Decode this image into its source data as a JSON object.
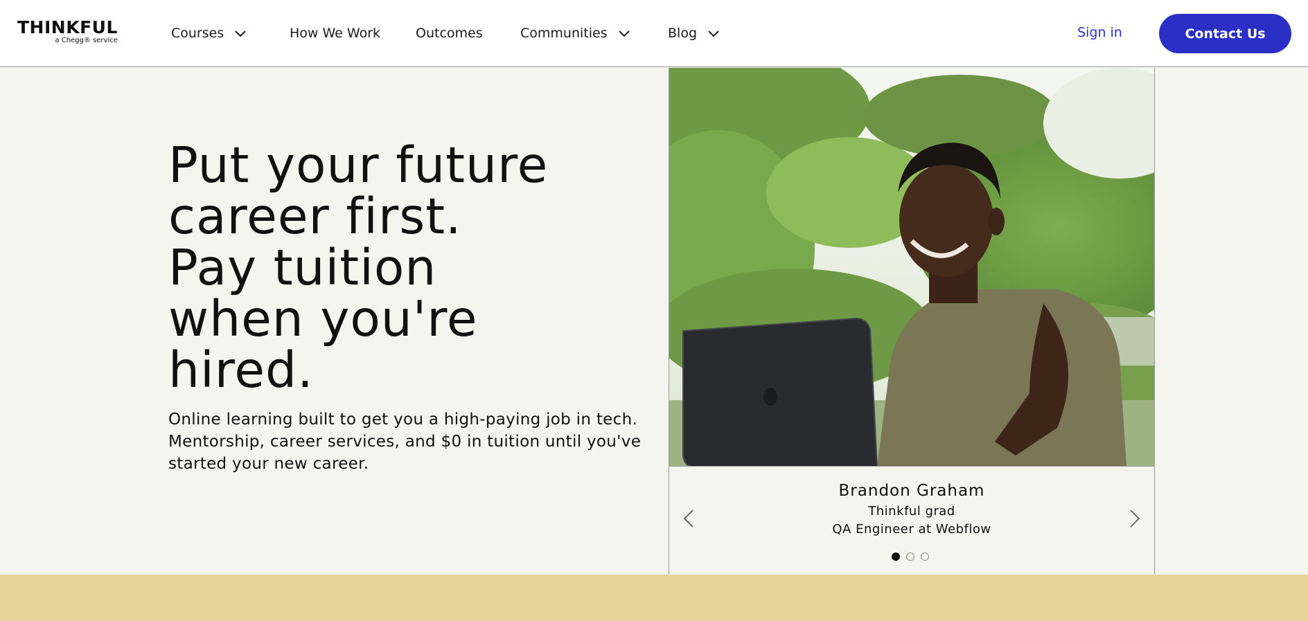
{
  "header": {
    "logo": {
      "word": "THINKFUL",
      "sub": "a Chegg® service"
    },
    "nav": [
      {
        "label": "Courses",
        "dropdown": true
      },
      {
        "label": "How We Work",
        "dropdown": false
      },
      {
        "label": "Outcomes",
        "dropdown": false
      },
      {
        "label": "Communities",
        "dropdown": true
      },
      {
        "label": "Blog",
        "dropdown": true
      }
    ],
    "sign_in": "Sign in",
    "contact": "Contact Us"
  },
  "hero": {
    "headline": "Put your future\ncareer first.\nPay tuition\nwhen you're\nhired.",
    "subtext": "Online learning built to get you a high-paying job in tech. Mentorship, career services, and $0 in tuition until you've started your new career."
  },
  "testimonial": {
    "name": "Brandon Graham",
    "line1": "Thinkful grad",
    "line2": "QA Engineer at Webflow",
    "slide_count": 3,
    "active_slide": 1
  },
  "colors": {
    "accent": "#2b2fc6",
    "background": "#f5f5ef",
    "band": "#e6d49b"
  }
}
